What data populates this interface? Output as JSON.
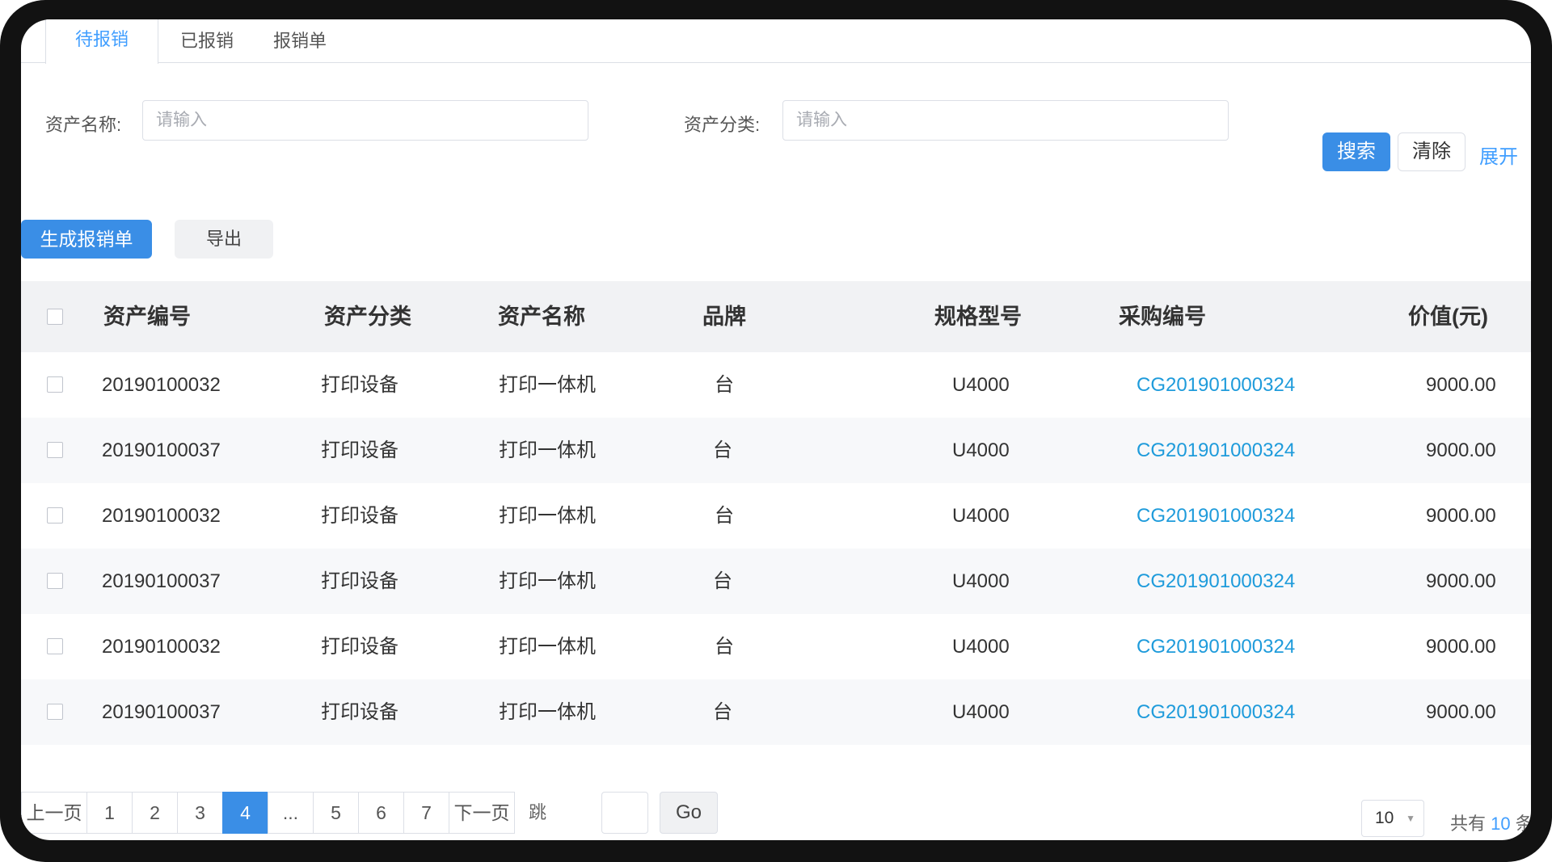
{
  "tabs": [
    {
      "label": "待报销",
      "active": true
    },
    {
      "label": "已报销",
      "active": false
    },
    {
      "label": "报销单",
      "active": false
    }
  ],
  "search": {
    "asset_name_label": "资产名称:",
    "asset_name_placeholder": "请输入",
    "asset_category_label": "资产分类:",
    "asset_category_placeholder": "请输入",
    "search_button": "搜索",
    "clear_button": "清除",
    "expand_link": "展开"
  },
  "toolbar": {
    "generate_button": "生成报销单",
    "export_button": "导出"
  },
  "table": {
    "columns": [
      "资产编号",
      "资产分类",
      "资产名称",
      "品牌",
      "规格型号",
      "采购编号",
      "价值(元)"
    ],
    "rows": [
      [
        "20190100032",
        "打印设备",
        "打印一体机",
        "台",
        "U4000",
        "CG201901000324",
        "9000.00"
      ],
      [
        "20190100037",
        "打印设备",
        "打印一体机",
        "台",
        "U4000",
        "CG201901000324",
        "9000.00"
      ],
      [
        "20190100032",
        "打印设备",
        "打印一体机",
        "台",
        "U4000",
        "CG201901000324",
        "9000.00"
      ],
      [
        "20190100037",
        "打印设备",
        "打印一体机",
        "台",
        "U4000",
        "CG201901000324",
        "9000.00"
      ],
      [
        "20190100032",
        "打印设备",
        "打印一体机",
        "台",
        "U4000",
        "CG201901000324",
        "9000.00"
      ],
      [
        "20190100037",
        "打印设备",
        "打印一体机",
        "台",
        "U4000",
        "CG201901000324",
        "9000.00"
      ]
    ]
  },
  "pagination": {
    "prev": "上一页",
    "pages": [
      "1",
      "2",
      "3",
      "4",
      "...",
      "5",
      "6",
      "7"
    ],
    "current": "4",
    "next": "下一页",
    "jump_label": "跳转到",
    "go": "Go",
    "page_size": "10",
    "total_prefix": "共有",
    "total_count": "10",
    "total_suffix": "条"
  },
  "colors": {
    "primary": "#3a8ee6",
    "link": "#1e9bdb",
    "header_bg": "#f1f2f4"
  }
}
